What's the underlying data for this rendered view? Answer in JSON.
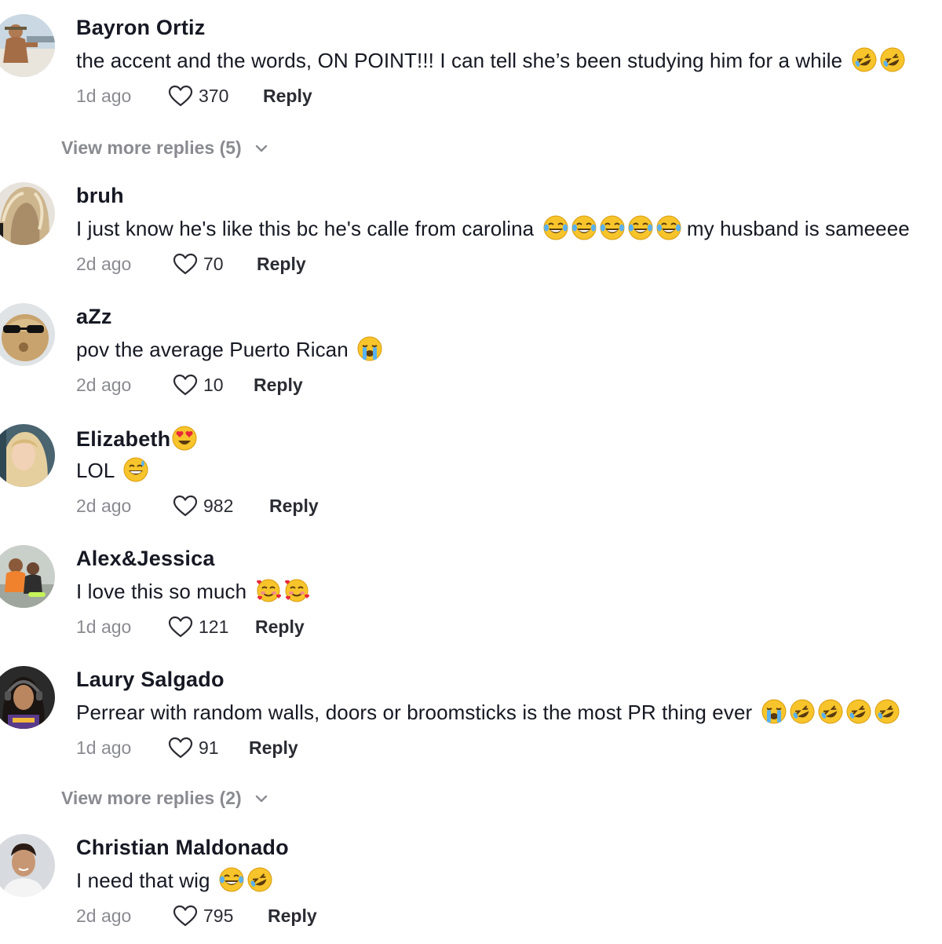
{
  "comments": [
    {
      "username": "Bayron Ortiz",
      "text": "the accent and the words, ON POINT!!! I can tell she’s been studying him for a while",
      "emojis": [
        "rofl-emoji",
        "rofl-emoji"
      ],
      "date": "1d ago",
      "likes": "370",
      "reply": "Reply"
    },
    {
      "username": "bruh",
      "text": "I just know he's like this bc he's calle from carolina",
      "emojis": [
        "tears-of-joy-emoji",
        "tears-of-joy-emoji",
        "tears-of-joy-emoji",
        "tears-of-joy-emoji",
        "tears-of-joy-emoji"
      ],
      "text_after": "my husband is sameeee",
      "date": "2d ago",
      "likes": "70",
      "reply": "Reply"
    },
    {
      "username": "aZz",
      "text": "pov the average Puerto Rican",
      "emojis": [
        "loudly-crying-emoji"
      ],
      "date": "2d ago",
      "likes": "10",
      "reply": "Reply"
    },
    {
      "username": "Elizabeth",
      "username_emoji": "heart-eyes-emoji",
      "text": "LOL",
      "emojis": [
        "grinning-sweat-emoji"
      ],
      "date": "2d ago",
      "likes": "982",
      "reply": "Reply"
    },
    {
      "username": "Alex&Jessica",
      "text": "I love this so much",
      "emojis": [
        "smiling-hearts-emoji",
        "smiling-hearts-emoji"
      ],
      "date": "1d ago",
      "likes": "121",
      "reply": "Reply"
    },
    {
      "username": "Laury Salgado",
      "text": "Perrear with random walls, doors or broomsticks is the most PR thing ever",
      "emojis": [
        "loudly-crying-emoji",
        "rofl-emoji",
        "rofl-emoji",
        "rofl-emoji",
        "rofl-emoji"
      ],
      "date": "1d ago",
      "likes": "91",
      "reply": "Reply"
    },
    {
      "username": "Christian Maldonado",
      "text": "I need that wig",
      "emojis": [
        "tears-of-joy-emoji",
        "rofl-emoji"
      ],
      "date": "2d ago",
      "likes": "795",
      "reply": "Reply"
    }
  ],
  "view_more": [
    {
      "label": "View more replies (5)"
    },
    {
      "label": "View more replies (2)"
    }
  ],
  "colors": {
    "text": "#161823",
    "muted": "#8a8b91",
    "background": "#ffffff"
  }
}
